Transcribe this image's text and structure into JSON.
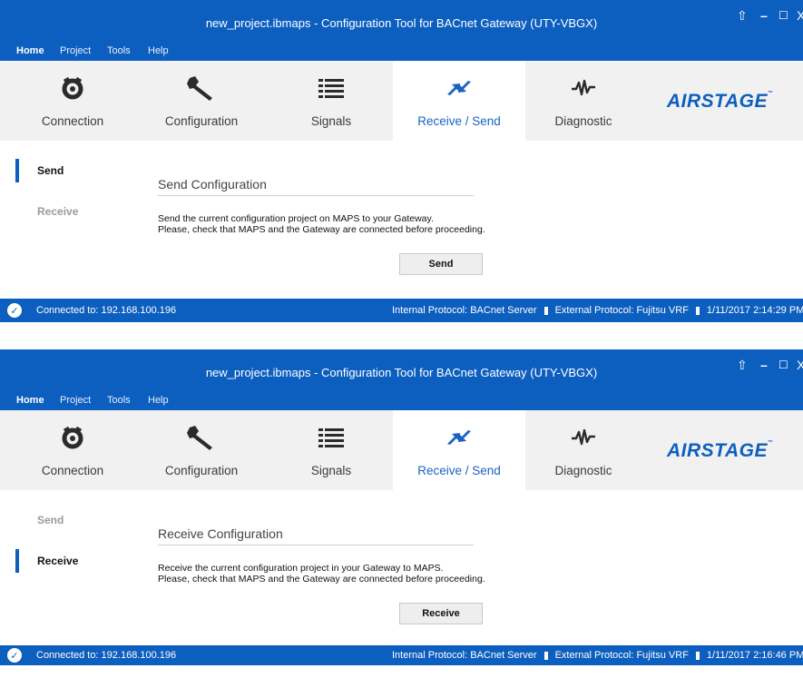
{
  "screens": [
    {
      "title": "new_project.ibmaps - Configuration Tool for BACnet Gateway (UTY-VBGX)",
      "window_controls": {
        "upload": "⇧",
        "minimize": "–",
        "maximize": "☐",
        "close": "X"
      },
      "menu": [
        "Home",
        "Project",
        "Tools",
        "Help"
      ],
      "ribbon_tabs": [
        "Connection",
        "Configuration",
        "Signals",
        "Receive / Send",
        "Diagnostic"
      ],
      "logo": {
        "text": "AIRSTAGE",
        "tm": "™"
      },
      "sidebar": [
        "Send",
        "Receive"
      ],
      "section_title": "Send Configuration",
      "description_line1": "Send the current configuration project on MAPS to your Gateway.",
      "description_line2": "Please, check that MAPS and the Gateway are connected before proceeding.",
      "button_label": "Send",
      "status": {
        "connected": "Connected to: 192.168.100.196",
        "internal": "Internal Protocol: BACnet Server",
        "external": "External Protocol: Fujitsu VRF",
        "timestamp": "1/11/2017 2:14:29 PM"
      }
    },
    {
      "title": "new_project.ibmaps - Configuration Tool for BACnet Gateway (UTY-VBGX)",
      "window_controls": {
        "upload": "⇧",
        "minimize": "–",
        "maximize": "☐",
        "close": "X"
      },
      "menu": [
        "Home",
        "Project",
        "Tools",
        "Help"
      ],
      "ribbon_tabs": [
        "Connection",
        "Configuration",
        "Signals",
        "Receive / Send",
        "Diagnostic"
      ],
      "logo": {
        "text": "AIRSTAGE",
        "tm": "™"
      },
      "sidebar": [
        "Send",
        "Receive"
      ],
      "section_title": "Receive Configuration",
      "description_line1": "Receive the current configuration project in your Gateway to MAPS.",
      "description_line2": "Please, check that MAPS and the Gateway are connected before proceeding.",
      "button_label": "Receive",
      "status": {
        "connected": "Connected to: 192.168.100.196",
        "internal": "Internal Protocol: BACnet Server",
        "external": "External Protocol: Fujitsu VRF",
        "timestamp": "1/11/2017 2:16:46 PM"
      }
    }
  ],
  "icons": {
    "connection": "gear-plug-icon",
    "configuration": "wrench-icon",
    "signals": "list-icon",
    "receive_send": "transfer-arrows-icon",
    "diagnostic": "pulse-icon",
    "status": "check-icon"
  },
  "colors": {
    "accent": "#0d5fbf",
    "selected_tab_text": "#1a63c4",
    "ribbon_bg": "#f1f1f1"
  }
}
